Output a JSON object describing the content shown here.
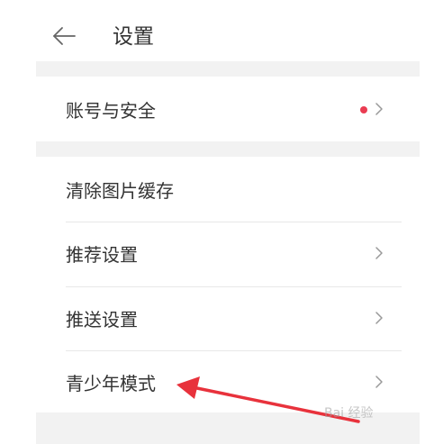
{
  "header": {
    "title": "设置",
    "back_icon": "arrow-left-icon"
  },
  "rows": [
    {
      "label": "账号与安全",
      "has_dot": true,
      "dot_color": "#ea3c52",
      "has_chevron": true
    },
    {
      "label": "清除图片缓存",
      "has_dot": false,
      "has_chevron": false
    },
    {
      "label": "推荐设置",
      "has_dot": false,
      "has_chevron": true
    },
    {
      "label": "推送设置",
      "has_dot": false,
      "has_chevron": true
    },
    {
      "label": "青少年模式",
      "has_dot": false,
      "has_chevron": true
    }
  ],
  "annotation": {
    "arrow_color": "#e8323c",
    "watermark": "Bai 经验"
  }
}
